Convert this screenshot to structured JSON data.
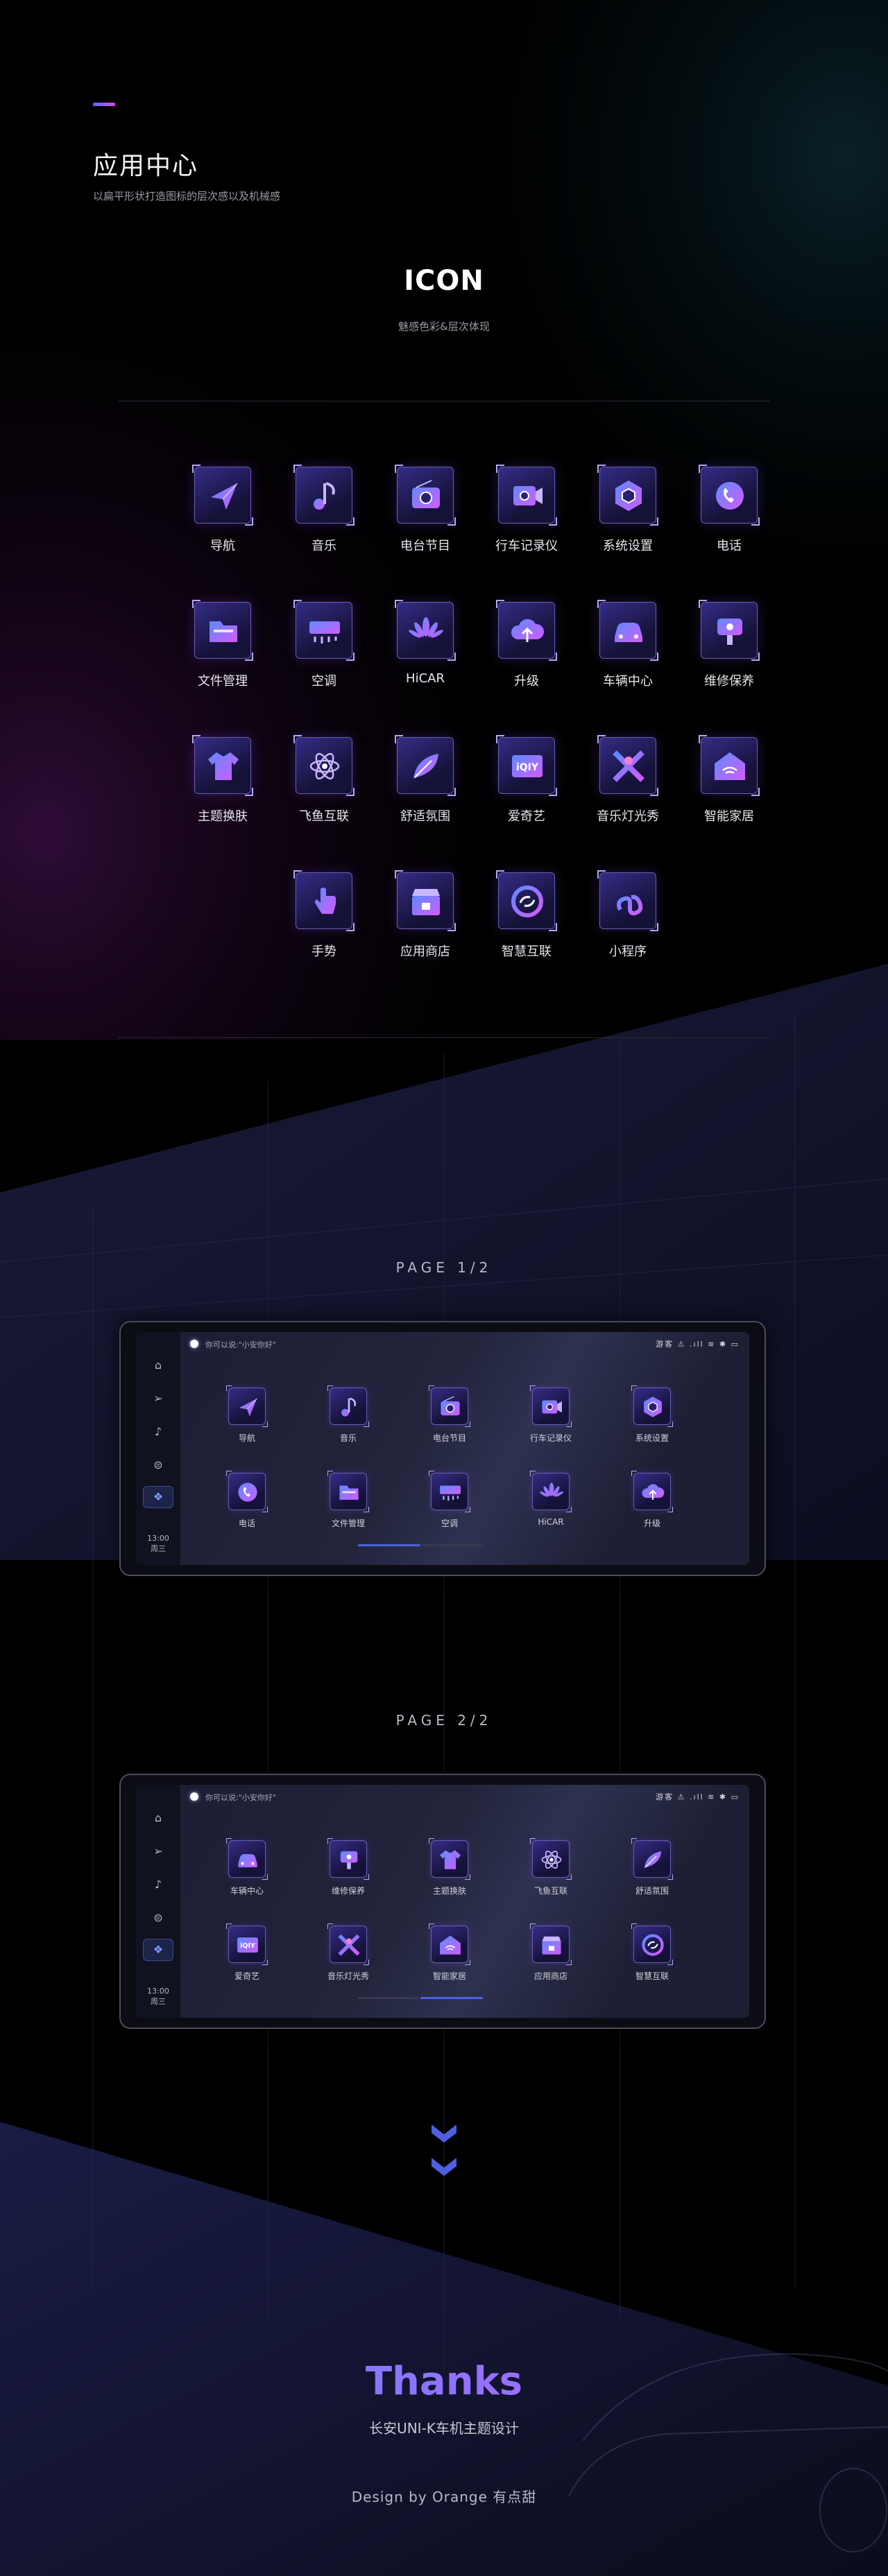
{
  "header": {
    "title": "应用中心",
    "subtitle": "以扁平形状打造图标的层次感以及机械感"
  },
  "icon_section": {
    "heading": "ICON",
    "subheading": "魅感色彩&层次体现"
  },
  "icons": [
    {
      "label": "导航",
      "icon": "navigation-arrow-icon"
    },
    {
      "label": "音乐",
      "icon": "music-note-icon"
    },
    {
      "label": "电台节目",
      "icon": "radio-icon"
    },
    {
      "label": "行车记录仪",
      "icon": "dashcam-icon"
    },
    {
      "label": "系统设置",
      "icon": "settings-hexagon-icon"
    },
    {
      "label": "电话",
      "icon": "phone-icon"
    },
    {
      "label": "文件管理",
      "icon": "folder-icon"
    },
    {
      "label": "空调",
      "icon": "air-conditioner-icon"
    },
    {
      "label": "HiCAR",
      "icon": "hicar-petal-icon"
    },
    {
      "label": "升级",
      "icon": "cloud-upgrade-icon"
    },
    {
      "label": "车辆中心",
      "icon": "car-icon"
    },
    {
      "label": "维修保养",
      "icon": "maintenance-icon"
    },
    {
      "label": "主题换肤",
      "icon": "tshirt-theme-icon"
    },
    {
      "label": "飞鱼互联",
      "icon": "atom-connect-icon"
    },
    {
      "label": "舒适氛围",
      "icon": "feather-ambient-icon"
    },
    {
      "label": "爱奇艺",
      "icon": "iqiyi-icon"
    },
    {
      "label": "音乐灯光秀",
      "icon": "light-show-icon"
    },
    {
      "label": "智能家居",
      "icon": "smart-home-icon"
    },
    {
      "label": "手势",
      "icon": "hand-gesture-icon"
    },
    {
      "label": "应用商店",
      "icon": "app-store-icon"
    },
    {
      "label": "智慧互联",
      "icon": "smart-link-icon"
    },
    {
      "label": "小程序",
      "icon": "mini-program-icon"
    }
  ],
  "pages": [
    {
      "label": "PAGE    1/2",
      "voice_prompt": "你可以说:\"小安你好\"",
      "status": "游客 ⚠ .ıll ≋ ✱ ▭",
      "clock_time": "13:00",
      "clock_day": "周三",
      "active_page": 1,
      "apps": [
        "导航",
        "音乐",
        "电台节目",
        "行车记录仪",
        "系统设置",
        "电话",
        "文件管理",
        "空调",
        "HiCAR",
        "升级"
      ],
      "app_icons": [
        "navigation-arrow-icon",
        "music-note-icon",
        "radio-icon",
        "dashcam-icon",
        "settings-hexagon-icon",
        "phone-icon",
        "folder-icon",
        "air-conditioner-icon",
        "hicar-petal-icon",
        "cloud-upgrade-icon"
      ]
    },
    {
      "label": "PAGE    2/2",
      "voice_prompt": "你可以说:\"小安你好\"",
      "status": "游客 ⚠ .ıll ≋ ✱ ▭",
      "clock_time": "13:00",
      "clock_day": "周三",
      "active_page": 2,
      "apps": [
        "车辆中心",
        "维修保养",
        "主题换肤",
        "飞鱼互联",
        "舒适氛围",
        "爱奇艺",
        "音乐灯光秀",
        "智能家居",
        "应用商店",
        "智慧互联"
      ],
      "app_icons": [
        "car-icon",
        "maintenance-icon",
        "tshirt-theme-icon",
        "atom-connect-icon",
        "feather-ambient-icon",
        "iqiyi-icon",
        "light-show-icon",
        "smart-home-icon",
        "app-store-icon",
        "smart-link-icon"
      ]
    }
  ],
  "sidebar_icons": [
    "home-icon",
    "navigation-icon",
    "music-icon",
    "media-icon",
    "apps-grid-icon"
  ],
  "footer": {
    "thanks": "Thanks",
    "project": "长安UNI-K车机主题设计",
    "credit": "Design by Orange 有点甜"
  },
  "colors": {
    "accent_blue": "#5d8bff",
    "accent_purple": "#c25bff",
    "accent_pink": "#e04bd4",
    "panel": "#1c1d33"
  }
}
